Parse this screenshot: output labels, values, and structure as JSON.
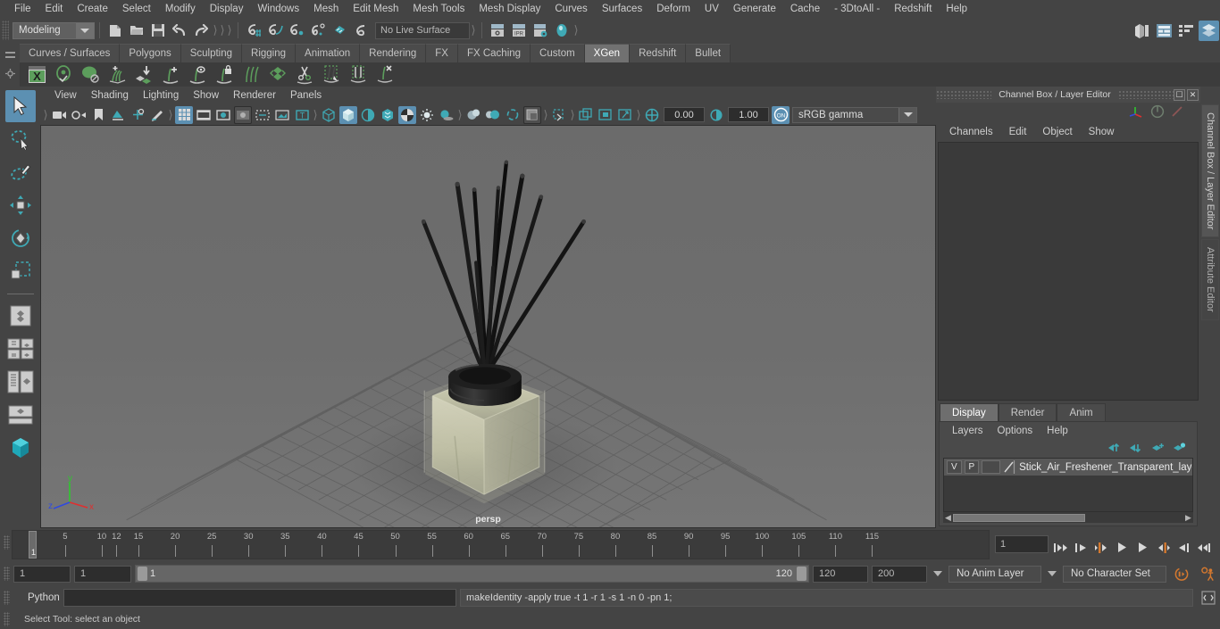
{
  "menubar": {
    "items": [
      "File",
      "Edit",
      "Create",
      "Select",
      "Modify",
      "Display",
      "Windows",
      "Mesh",
      "Edit Mesh",
      "Mesh Tools",
      "Mesh Display",
      "Curves",
      "Surfaces",
      "Deform",
      "UV",
      "Generate",
      "Cache",
      "- 3DtoAll -",
      "Redshift",
      "Help"
    ]
  },
  "statusline": {
    "menu_set": "Modeling",
    "live_surface": "No Live Surface",
    "icons": [
      "new-scene-icon",
      "open-scene-icon",
      "save-scene-icon",
      "undo-icon",
      "redo-icon",
      "select-by-hierarchy-icon",
      "select-by-object-icon",
      "select-by-component-icon",
      "snap-to-grid-icon",
      "snap-to-curve-icon",
      "snap-to-point-icon",
      "snap-to-projected-center-icon",
      "snap-to-view-plane-icon",
      "make-live-icon",
      "render-current-frame-icon",
      "ipr-render-icon",
      "render-settings-icon",
      "hypershade-icon"
    ],
    "editor_toggles": [
      "modeling-editors-icon",
      "attribute-editor-icon",
      "tool-settings-icon",
      "channel-box-layer-editor-icon"
    ],
    "active_editor_toggle": "channel-box-layer-editor-icon"
  },
  "shelf": {
    "tabs": [
      "Curves / Surfaces",
      "Polygons",
      "Sculpting",
      "Rigging",
      "Animation",
      "Rendering",
      "FX",
      "FX Caching",
      "Custom",
      "XGen",
      "Redshift",
      "Bullet"
    ],
    "active_tab": "XGen",
    "icons": [
      "xgen-editor-icon",
      "xgen-preview-icon",
      "xgen-guide-icon",
      "xgen-add-density-icon",
      "xgen-place-icon",
      "xgen-add-guide-icon",
      "xgen-select-guide-icon",
      "xgen-lock-guide-icon",
      "xgen-comb-icon",
      "xgen-clump-icon",
      "xgen-cut-icon",
      "xgen-sculpt-icon",
      "xgen-noise-icon",
      "xgen-delete-icon"
    ]
  },
  "toolbox": {
    "tools": [
      "select-tool",
      "lasso-select-tool",
      "paint-select-tool",
      "move-tool",
      "rotate-tool",
      "scale-tool",
      "last-tool",
      "single-pane-layout-icon",
      "two-pane-layout-icon",
      "four-pane-layout-icon",
      "outliner-persp-layout-icon",
      "persp-graph-layout-icon",
      "hypershade-persp-layout-icon"
    ],
    "active_tool": "select-tool"
  },
  "viewport": {
    "menu": [
      "View",
      "Shading",
      "Lighting",
      "Show",
      "Renderer",
      "Panels"
    ],
    "label": "persp",
    "exposure": "0.00",
    "gamma": "1.00",
    "color_management": "sRGB gamma",
    "axis_labels": {
      "x": "x",
      "y": "y",
      "z": "z"
    },
    "toolbar_icons": [
      "select-camera-icon",
      "camera-attributes-icon",
      "bookmark-icon",
      "image-plane-icon",
      "two-d-pan-zoom-icon",
      "grease-pencil-icon",
      "grid-toggle-icon",
      "film-gate-icon",
      "resolution-gate-icon",
      "gate-mask-icon",
      "film-origin-icon",
      "safe-action-icon",
      "text-overlay-icon",
      "wireframe-icon",
      "smooth-shade-all-icon",
      "shaded-wireframe-icon",
      "hardware-texturing-icon",
      "use-default-material-icon",
      "lighting-icon",
      "shadows-icon",
      "screen-space-ao-icon",
      "motion-blur-icon",
      "multisample-icon",
      "isolate-select-icon",
      "xray-icon",
      "xray-joints-icon",
      "xray-active-components-icon",
      "exposure-icon",
      "gamma-icon",
      "color-management-toggle-icon"
    ],
    "active_toolbar_icons": [
      "grid-toggle-icon",
      "smooth-shade-all-icon",
      "multisample-icon",
      "color-management-toggle-icon"
    ]
  },
  "channel_box": {
    "title": "Channel Box / Layer Editor",
    "window_buttons": [
      "undock-icon",
      "close-icon"
    ],
    "header_icons": [
      "axis-gizmo-icon",
      "disabled-toggle-icon",
      "red-slash-icon"
    ],
    "menu": [
      "Channels",
      "Edit",
      "Object",
      "Show"
    ],
    "content": ""
  },
  "layer_editor": {
    "tabs": [
      "Display",
      "Render",
      "Anim"
    ],
    "active_tab": "Display",
    "menu": [
      "Layers",
      "Options",
      "Help"
    ],
    "tool_icons": [
      "move-layer-up-icon",
      "move-layer-down-icon",
      "new-layer-icon",
      "new-layer-from-selected-icon"
    ],
    "layers": [
      {
        "visibility": "V",
        "playback": "P",
        "shading": "",
        "name": "Stick_Air_Freshener_Transparent_laye"
      }
    ]
  },
  "side_tabs": {
    "items": [
      "Channel Box / Layer Editor",
      "Attribute Editor"
    ],
    "active": "Channel Box / Layer Editor"
  },
  "timeline": {
    "current_frame_marker": "1",
    "current_frame_field": "1",
    "tick_labels": [
      "5",
      "10",
      "15",
      "20",
      "25",
      "30",
      "35",
      "40",
      "45",
      "50",
      "55",
      "60",
      "65",
      "70",
      "75",
      "80",
      "85",
      "90",
      "95",
      "100",
      "105",
      "110",
      "115",
      "12"
    ],
    "playback_buttons": [
      "go-to-start-icon",
      "step-back-frame-icon",
      "step-back-key-icon",
      "play-backwards-icon",
      "play-forwards-icon",
      "step-forward-key-icon",
      "step-forward-frame-icon",
      "go-to-end-icon"
    ]
  },
  "range": {
    "anim_start": "1",
    "range_start": "1",
    "slider_start_label": "1",
    "slider_end_label": "120",
    "range_end": "120",
    "anim_end": "200",
    "anim_layer": "No Anim Layer",
    "character_set": "No Character Set",
    "icons": [
      "auto-keyframe-icon",
      "animation-preferences-icon"
    ]
  },
  "command_line": {
    "language_label": "Python",
    "input_value": "",
    "output": "makeIdentity -apply true -t 1 -r 1 -s 1 -n 0 -pn 1;",
    "script_editor_icon": "script-editor-icon"
  },
  "help_line": {
    "text": "Select Tool: select an object"
  },
  "colors": {
    "accent_blue": "#5c90b2",
    "shelf_green": "#5c9e5c",
    "teal": "#3fa9b5",
    "orange": "#d3782f",
    "panel_bg": "#444444",
    "viewport_bg": "#6e6e6e"
  }
}
